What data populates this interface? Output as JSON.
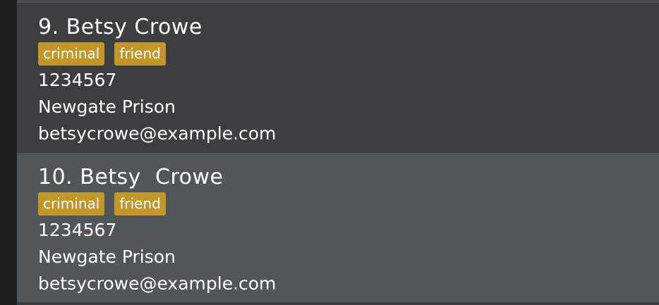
{
  "colors": {
    "card_odd_bg": "#3c3e3f",
    "card_even_bg": "#515658",
    "tag_bg": "#c29628",
    "text": "#ffffff"
  },
  "persons": [
    {
      "name": "9. Betsy Crowe",
      "tags": [
        "criminal",
        "friend"
      ],
      "phone": "1234567",
      "address": "Newgate Prison",
      "email": "betsycrowe@example.com"
    },
    {
      "name": "10. Betsy  Crowe",
      "tags": [
        "criminal",
        "friend"
      ],
      "phone": "1234567",
      "address": "Newgate Prison",
      "email": "betsycrowe@example.com"
    }
  ]
}
